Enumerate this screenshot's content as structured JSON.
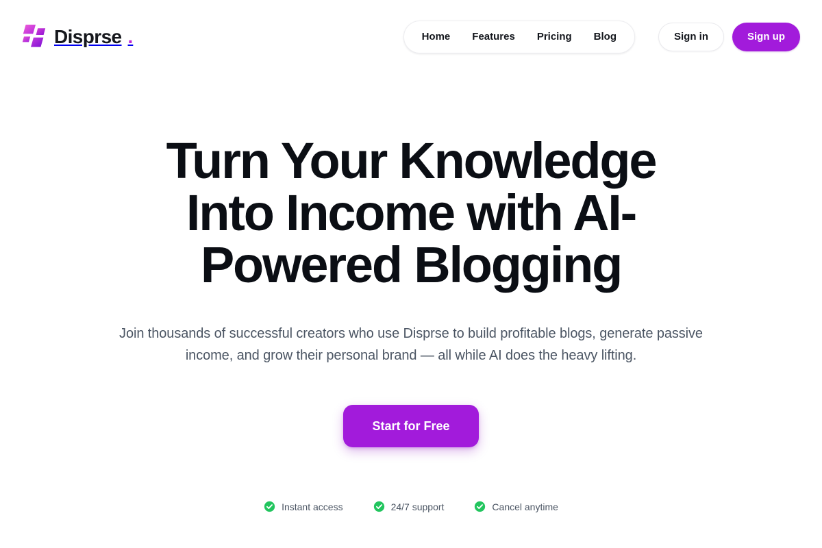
{
  "header": {
    "brand": {
      "name": "Disprse",
      "dot": ".",
      "logo_icon": "disprse-parallelogram-logo",
      "colors": {
        "mark_start": "#e052c8",
        "mark_end": "#8b14d6",
        "dot": "#c026d3"
      }
    },
    "nav": {
      "items": [
        {
          "label": "Home"
        },
        {
          "label": "Features"
        },
        {
          "label": "Pricing"
        },
        {
          "label": "Blog"
        }
      ]
    },
    "auth": {
      "sign_in_label": "Sign in",
      "sign_up_label": "Sign up"
    }
  },
  "hero": {
    "title": "Turn Your Knowledge Into Income with AI-Powered Blogging",
    "subtitle": "Join thousands of successful creators who use Disprse to build profitable blogs, generate passive income, and grow their personal brand — all while AI does the heavy lifting.",
    "cta_label": "Start for Free",
    "badges": [
      {
        "label": "Instant access",
        "icon": "check-circle-icon"
      },
      {
        "label": "24/7 support",
        "icon": "check-circle-icon"
      },
      {
        "label": "Cancel anytime",
        "icon": "check-circle-icon"
      }
    ]
  },
  "theme": {
    "accent": "#a21bdb",
    "badge_green": "#22c55e",
    "heading": "#0b0e14",
    "body_text": "#4b5563",
    "background": "#ffffff"
  }
}
